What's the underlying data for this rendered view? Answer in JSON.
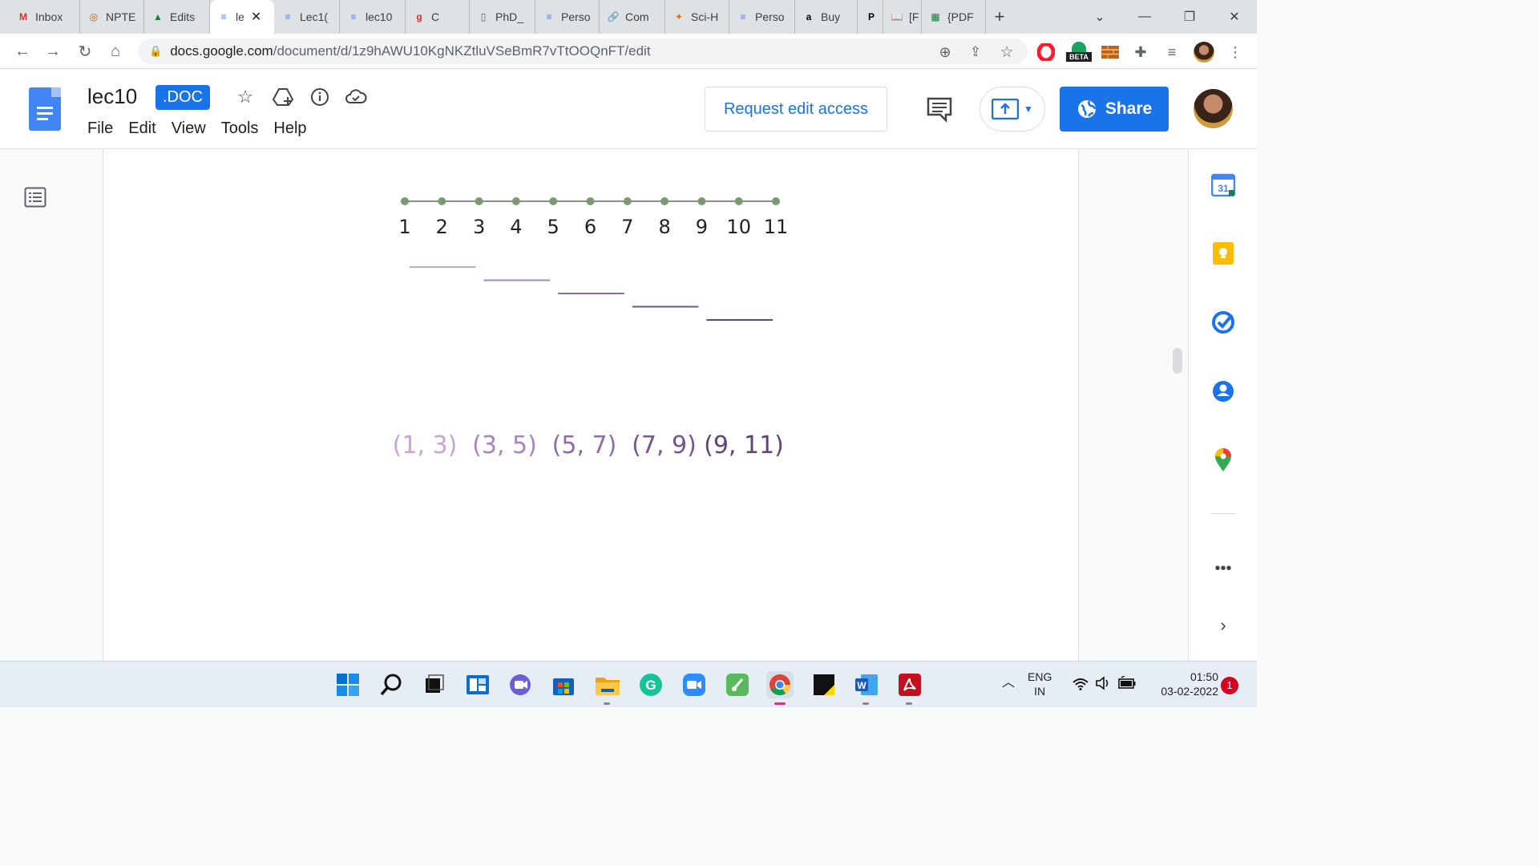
{
  "browser": {
    "tabs": [
      {
        "label": "Inbox",
        "icon": "gmail-icon",
        "glyph": "M",
        "color": "#d93025"
      },
      {
        "label": "NPTE",
        "icon": "nptel-icon",
        "glyph": "◎",
        "color": "#b06000"
      },
      {
        "label": "Edits",
        "icon": "drive-icon",
        "glyph": "▲",
        "color": "#188038"
      },
      {
        "label": "le",
        "icon": "docs-icon",
        "glyph": "≡",
        "color": "#4285f4",
        "active": true
      },
      {
        "label": "Lec1(",
        "icon": "docs-icon",
        "glyph": "≡",
        "color": "#4285f4"
      },
      {
        "label": "lec10",
        "icon": "docs-icon",
        "glyph": "≡",
        "color": "#4285f4"
      },
      {
        "label": "C",
        "icon": "g-icon",
        "glyph": "g",
        "color": "#d93025"
      },
      {
        "label": "PhD_",
        "icon": "file-icon",
        "glyph": "▯",
        "color": "#5f6368"
      },
      {
        "label": "Perso",
        "icon": "docs-icon",
        "glyph": "≡",
        "color": "#4285f4"
      },
      {
        "label": "Com",
        "icon": "link-icon",
        "glyph": "🔗",
        "color": "#1a73e8"
      },
      {
        "label": "Sci-H",
        "icon": "scihub-icon",
        "glyph": "✦",
        "color": "#e37400"
      },
      {
        "label": "Perso",
        "icon": "docs-icon",
        "glyph": "≡",
        "color": "#4285f4"
      },
      {
        "label": "Buy",
        "icon": "amazon-icon",
        "glyph": "a",
        "color": "#000000"
      },
      {
        "label": "",
        "icon": "p-icon",
        "glyph": "P",
        "color": "#000000"
      },
      {
        "label": "[F",
        "icon": "book-icon",
        "glyph": "📖",
        "color": "#5f6368"
      },
      {
        "label": "{PDF",
        "icon": "pdf-site-icon",
        "glyph": "▦",
        "color": "#188038"
      }
    ],
    "close_glyph": "✕",
    "new_tab_glyph": "+",
    "url_domain": "docs.google.com",
    "url_path": "/document/d/1z9hAWU10KgNKZtluVSeBmR7vTtOOQnFT/edit",
    "beta_label": "BETA"
  },
  "doc": {
    "title": "lec10",
    "badge": ".DOC",
    "menu": [
      "File",
      "Edit",
      "View",
      "Tools",
      "Help"
    ],
    "request_edit_label": "Request edit access",
    "share_label": "Share"
  },
  "figure": {
    "number_line_labels": [
      "1",
      "2",
      "3",
      "4",
      "5",
      "6",
      "7",
      "8",
      "9",
      "10",
      "11"
    ],
    "intervals": [
      {
        "label": "(1, 3)",
        "start": 1,
        "end": 3,
        "color": "#c7a6d6"
      },
      {
        "label": "(3, 5)",
        "start": 3,
        "end": 5,
        "color": "#a886bd"
      },
      {
        "label": "(5, 7)",
        "start": 5,
        "end": 7,
        "color": "#8e6da6"
      },
      {
        "label": "(7, 9)",
        "start": 7,
        "end": 9,
        "color": "#735690"
      },
      {
        "label": "(9, 11)",
        "start": 9,
        "end": 11,
        "color": "#5f4478"
      }
    ],
    "dot_color": "#7a9a72"
  },
  "taskbar": {
    "language": "ENG",
    "region": "IN",
    "time": "01:50",
    "date": "03-02-2022",
    "notification_count": "1"
  }
}
